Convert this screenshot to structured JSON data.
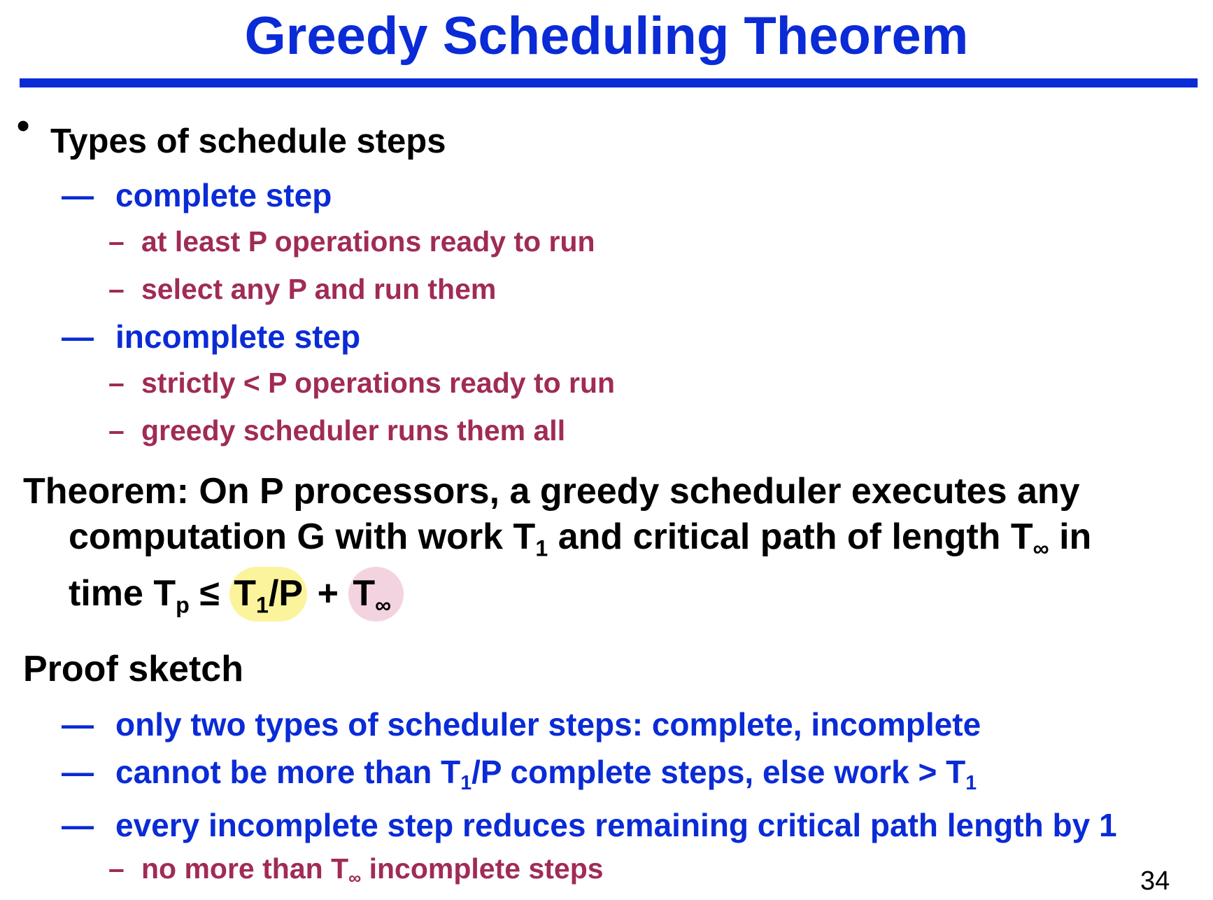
{
  "title": "Greedy Scheduling Theorem",
  "colors": {
    "title": "#0a2bd6",
    "accent_blue": "#0a2bd6",
    "accent_red": "#a02b56",
    "highlight_yellow": "#fbf49c",
    "highlight_pink": "#f3d3df"
  },
  "section1": {
    "bullet": "•",
    "heading": "Types of schedule steps",
    "items": [
      {
        "dash": "—",
        "label": "complete step",
        "sub": [
          {
            "dash": "–",
            "text": "at least P operations ready to run"
          },
          {
            "dash": "–",
            "text": "select any P and run them"
          }
        ]
      },
      {
        "dash": "—",
        "label": "incomplete step",
        "sub": [
          {
            "dash": "–",
            "text": "strictly < P operations ready to run"
          },
          {
            "dash": "–",
            "text": "greedy scheduler runs them all"
          }
        ]
      }
    ]
  },
  "theorem": {
    "line1": "Theorem: On P processors, a greedy scheduler executes any",
    "line2_a": "computation G with work T",
    "line2_sub1": "1",
    "line2_b": " and critical path of length T",
    "line2_sub2": "∞",
    "line2_c": " in",
    "line3_a": "time T",
    "line3_sub_p": "p",
    "line3_leq": " ≤ ",
    "hl1_T": "T",
    "hl1_sub": "1",
    "hl1_rest": "/P",
    "plus": " + ",
    "hl2_T": "T",
    "hl2_sub": "∞"
  },
  "proof": {
    "heading": "Proof sketch",
    "items": [
      {
        "dash": "—",
        "text": "only two types of scheduler steps: complete, incomplete"
      },
      {
        "dash": "—",
        "a": "cannot be more than T",
        "sub1": "1",
        "b": "/P complete steps, else work > T",
        "sub2": "1"
      },
      {
        "dash": "—",
        "text": "every incomplete step reduces remaining critical path length by 1"
      }
    ],
    "sub": {
      "dash": "–",
      "a": "no more than T",
      "sub": "∞",
      "b": " incomplete steps"
    }
  },
  "page_number": "34"
}
